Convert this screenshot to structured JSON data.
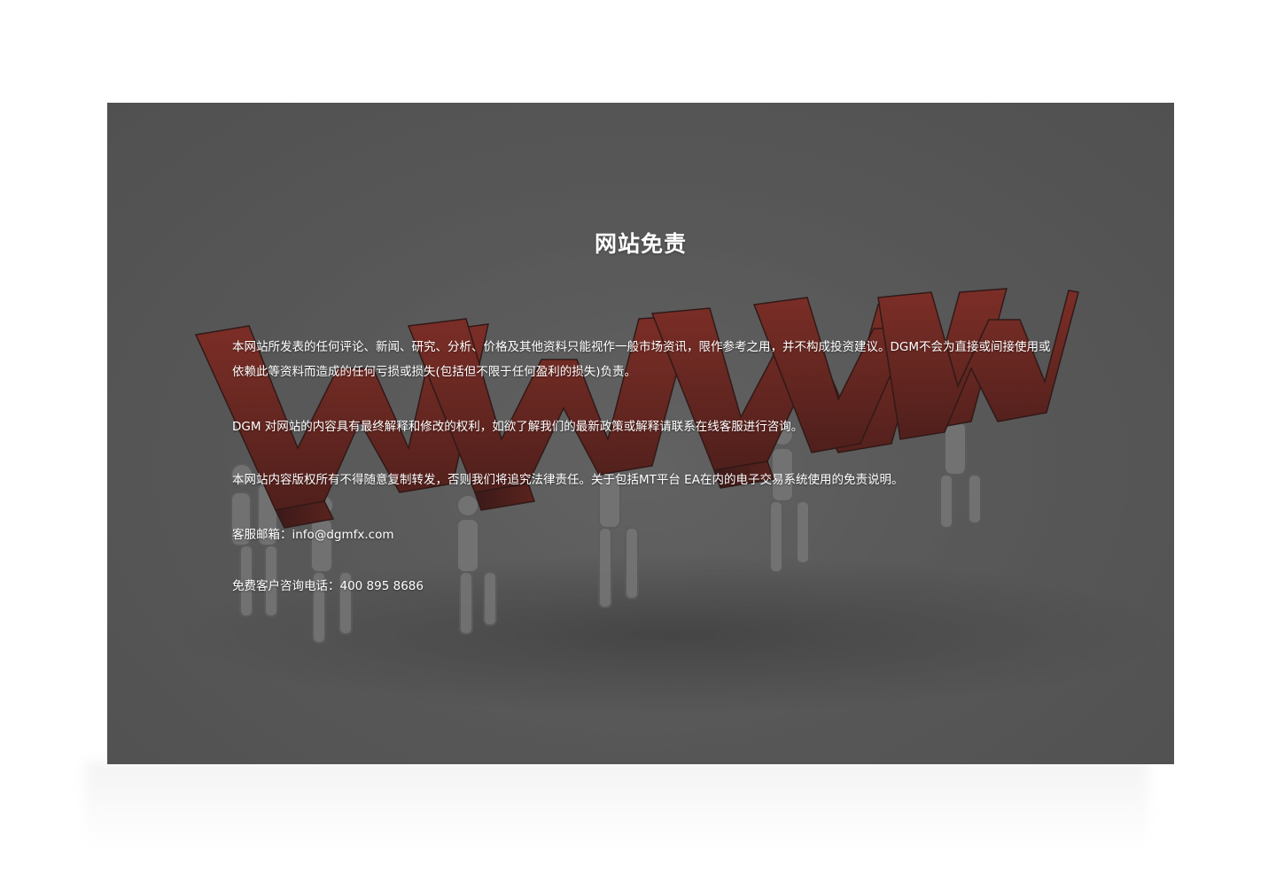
{
  "disclaimer": {
    "title": "网站免责",
    "paragraph_1": "本网站所发表的任何评论、新闻、研究、分析、价格及其他资料只能视作一般市场资讯，限作参考之用，并不构成投资建议。DGM不会为直接或间接使用或依赖此等资料而造成的任何亏损或损失(包括但不限于任何盈利的损失)负责。",
    "paragraph_2": "DGM 对网站的内容具有最终解释和修改的权利，如欲了解我们的最新政策或解释请联系在线客服进行咨询。",
    "paragraph_3": "本网站内容版权所有不得随意复制转发，否则我们将追究法律责任。关于包括MT平台 EA在内的电子交易系统使用的免责说明。",
    "email_label": "客服邮箱：",
    "email": "info@dgmfx.com",
    "phone_label": "免费客户咨询电话：",
    "phone": "400 895 8686"
  },
  "colors": {
    "panel_background": "#646464",
    "letter_red": "#8a1a10",
    "text": "#ffffff"
  }
}
